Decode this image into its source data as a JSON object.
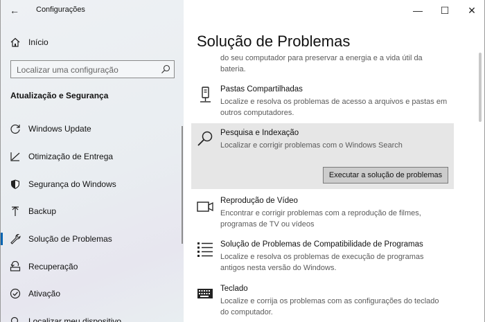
{
  "window": {
    "title": "Configurações",
    "minimize": "—",
    "maximize": "☐",
    "close": "✕"
  },
  "sidebar": {
    "back": "←",
    "home_label": "Início",
    "search_placeholder": "Localizar uma configuração",
    "section_title": "Atualização e Segurança",
    "items": [
      {
        "label": "Windows Update",
        "icon": "refresh-icon"
      },
      {
        "label": "Otimização de Entrega",
        "icon": "delivery-optimization-icon"
      },
      {
        "label": "Segurança do Windows",
        "icon": "shield-icon"
      },
      {
        "label": "Backup",
        "icon": "backup-arrow-icon"
      },
      {
        "label": "Solução de Problemas",
        "icon": "wrench-icon",
        "active": true
      },
      {
        "label": "Recuperação",
        "icon": "recovery-icon"
      },
      {
        "label": "Ativação",
        "icon": "activation-check-icon"
      },
      {
        "label": "Localizar meu dispositivo",
        "icon": "find-device-icon"
      }
    ]
  },
  "main": {
    "title": "Solução de Problemas",
    "continued_desc": "do seu computador para preservar a energia e a vida útil da bateria.",
    "items": [
      {
        "name": "Pastas Compartilhadas",
        "desc": "Localize e resolva os problemas de acesso a arquivos e pastas em outros computadores.",
        "icon": "shared-folder-icon"
      },
      {
        "name": "Pesquisa e Indexação",
        "desc": "Localizar e corrigir problemas com o Windows Search",
        "icon": "search-icon"
      },
      {
        "name": "Reprodução de Vídeo",
        "desc": "Encontrar e corrigir problemas com a reprodução de filmes, programas de TV ou vídeos",
        "icon": "video-camera-icon"
      },
      {
        "name": "Solução de Problemas de Compatibilidade de Programas",
        "desc": "Localize e resolva os problemas de execução de programas antigos nesta versão do Windows.",
        "icon": "list-icon"
      },
      {
        "name": "Teclado",
        "desc": "Localize e corrija os problemas com as configurações do teclado do computador.",
        "icon": "keyboard-icon"
      }
    ],
    "run_button": "Executar a solução de problemas"
  }
}
